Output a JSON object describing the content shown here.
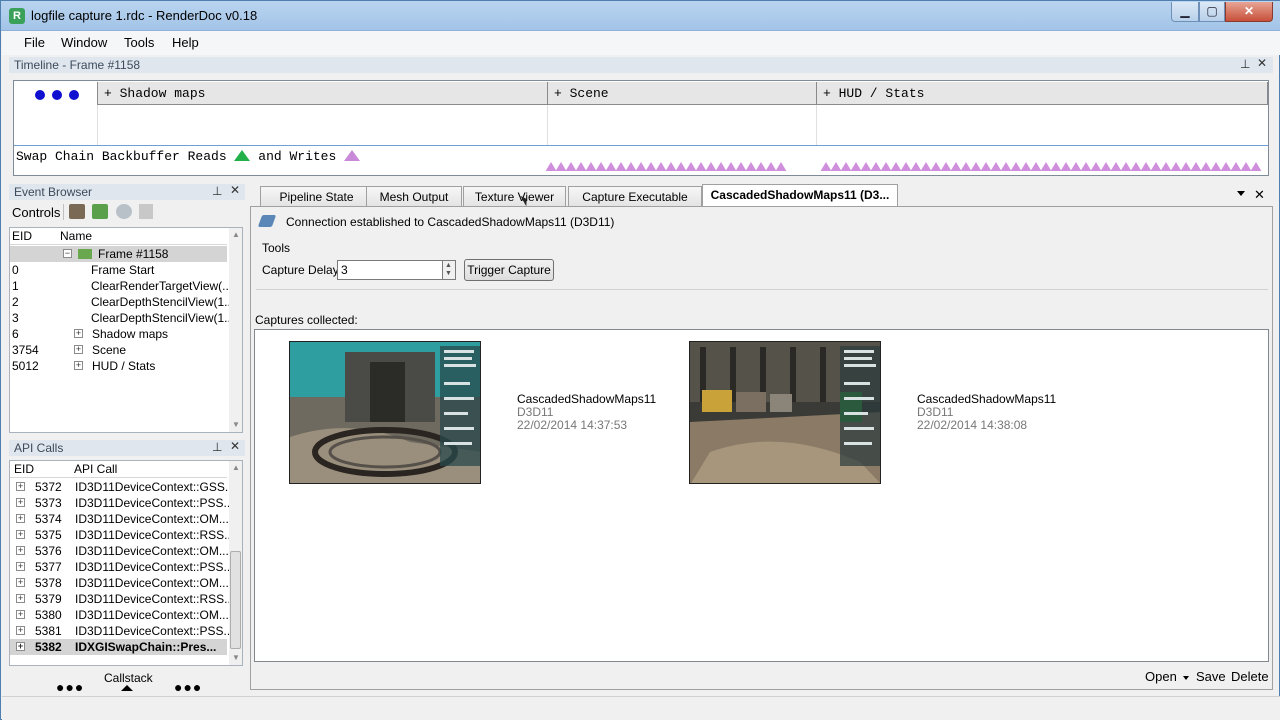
{
  "window": {
    "title": "logfile capture 1.rdc - RenderDoc v0.18",
    "app_icon": "renderdoc-icon"
  },
  "window_buttons": {
    "minimize": "▁",
    "maximize": "▢",
    "close": "✕"
  },
  "menubar": {
    "items": [
      "File",
      "Window",
      "Tools",
      "Help"
    ]
  },
  "timeline": {
    "title": "Timeline - Frame #1158",
    "sections": [
      "+ Shadow maps",
      "+ Scene",
      "+ HUD / Stats"
    ],
    "legend_text": "Swap Chain Backbuffer Reads",
    "legend_and": "and Writes"
  },
  "event_browser": {
    "title": "Event Browser",
    "controls_label": "Controls",
    "columns": [
      "EID",
      "Name"
    ],
    "rows": [
      {
        "eid": "",
        "name": "Frame #1158"
      },
      {
        "eid": "0",
        "name": "Frame Start"
      },
      {
        "eid": "1",
        "name": "ClearRenderTargetView(..."
      },
      {
        "eid": "2",
        "name": "ClearDepthStencilView(1...."
      },
      {
        "eid": "3",
        "name": "ClearDepthStencilView(1...."
      },
      {
        "eid": "6",
        "name": "Shadow maps"
      },
      {
        "eid": "3754",
        "name": "Scene"
      },
      {
        "eid": "5012",
        "name": "HUD / Stats"
      }
    ]
  },
  "api_calls": {
    "title": "API Calls",
    "columns": [
      "EID",
      "API Call"
    ],
    "rows": [
      {
        "eid": "5372",
        "call": "ID3D11DeviceContext::GSS..."
      },
      {
        "eid": "5373",
        "call": "ID3D11DeviceContext::PSS..."
      },
      {
        "eid": "5374",
        "call": "ID3D11DeviceContext::OM..."
      },
      {
        "eid": "5375",
        "call": "ID3D11DeviceContext::RSS..."
      },
      {
        "eid": "5376",
        "call": "ID3D11DeviceContext::OM..."
      },
      {
        "eid": "5377",
        "call": "ID3D11DeviceContext::PSS..."
      },
      {
        "eid": "5378",
        "call": "ID3D11DeviceContext::OM..."
      },
      {
        "eid": "5379",
        "call": "ID3D11DeviceContext::RSS..."
      },
      {
        "eid": "5380",
        "call": "ID3D11DeviceContext::OM..."
      },
      {
        "eid": "5381",
        "call": "ID3D11DeviceContext::PSS..."
      },
      {
        "eid": "5382",
        "call": "IDXGISwapChain::Pres..."
      }
    ],
    "callstack_label": "Callstack"
  },
  "tabs": [
    "Pipeline State",
    "Mesh Output",
    "Texture Viewer",
    "Capture Executable",
    "CascadedShadowMaps11 (D3..."
  ],
  "connection": {
    "status": "Connection established to CascadedShadowMaps11 (D3D11)",
    "tools_label": "Tools",
    "capture_delay_label": "Capture Delay",
    "capture_delay_value": "3",
    "trigger_button": "Trigger Capture",
    "captures_label": "Captures collected:"
  },
  "captures": [
    {
      "name": "CascadedShadowMaps11",
      "api": "D3D11",
      "timestamp": "22/02/2014 14:37:53"
    },
    {
      "name": "CascadedShadowMaps11",
      "api": "D3D11",
      "timestamp": "22/02/2014 14:38:08"
    }
  ],
  "footer_actions": {
    "open": "Open",
    "save": "Save",
    "delete": "Delete"
  },
  "colors": {
    "accent": "#1010d0",
    "read_marker": "#22b04a",
    "write_marker": "#c889d8",
    "titlebar": "#a3c4e8"
  }
}
